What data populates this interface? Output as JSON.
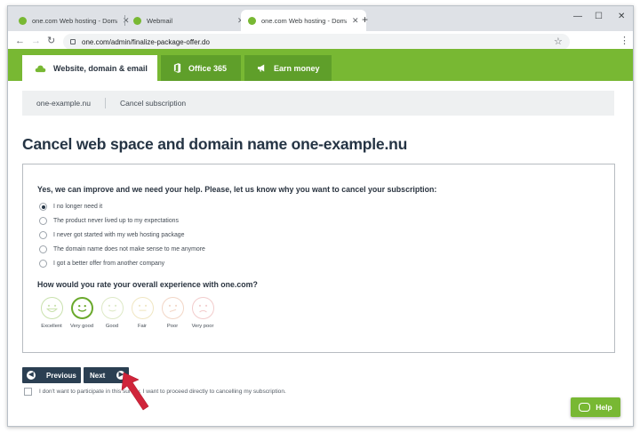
{
  "browser": {
    "tabs": [
      {
        "title": "one.com Web hosting - Domain",
        "active": false
      },
      {
        "title": "Webmail",
        "active": false
      },
      {
        "title": "one.com Web hosting - Domain",
        "active": true
      }
    ],
    "new_tab_symbol": "+",
    "window_controls": {
      "minimize": "—",
      "maximize": "☐",
      "close": "✕"
    },
    "url": "one.com/admin/finalize-package-offer.do",
    "icons": {
      "favicon_color": "#78b833"
    }
  },
  "nav": {
    "tabs": [
      {
        "label": "Website, domain & email",
        "icon": "cloud-icon",
        "active": true
      },
      {
        "label": "Office 365",
        "icon": "office-icon",
        "active": false
      },
      {
        "label": "Earn money",
        "icon": "megaphone-icon",
        "active": false
      }
    ],
    "bar_color": "#78b833"
  },
  "breadcrumb": {
    "items": [
      "one-example.nu",
      "Cancel subscription"
    ]
  },
  "page": {
    "title": "Cancel web space and domain name one-example.nu"
  },
  "survey": {
    "question1": "Yes, we can improve and we need your help. Please, let us know why you want to cancel your subscription:",
    "reasons": [
      {
        "label": "I no longer need it",
        "selected": true
      },
      {
        "label": "The product never lived up to my expectations",
        "selected": false
      },
      {
        "label": "I never got started with my web hosting package",
        "selected": false
      },
      {
        "label": "The domain name does not make sense to me anymore",
        "selected": false
      },
      {
        "label": "I got a better offer from another company",
        "selected": false
      }
    ],
    "question2": "How would you rate your overall experience with one.com?",
    "ratings": [
      {
        "label": "Excellent",
        "selected": false
      },
      {
        "label": "Very good",
        "selected": true
      },
      {
        "label": "Good",
        "selected": false
      },
      {
        "label": "Fair",
        "selected": false
      },
      {
        "label": "Poor",
        "selected": false
      },
      {
        "label": "Very poor",
        "selected": false
      }
    ]
  },
  "buttons": {
    "previous": "Previous",
    "next": "Next",
    "help": "Help"
  },
  "optout": {
    "label": "I don't want to participate in this survey. I want to proceed directly to cancelling my subscription.",
    "checked": false
  },
  "colors": {
    "brand_green": "#78b833",
    "dark_navy": "#2b3f52",
    "annotation_red": "#d0243a"
  }
}
